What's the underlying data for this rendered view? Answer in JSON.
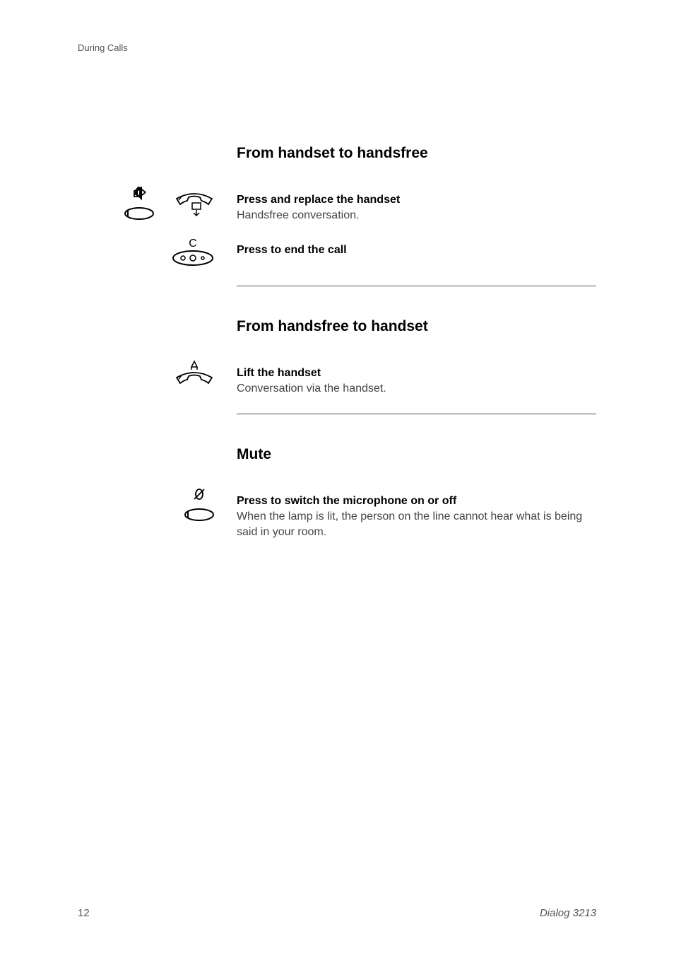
{
  "header": {
    "section_label": "During Calls"
  },
  "sections": [
    {
      "title": "From handset to handsfree",
      "rows": [
        {
          "bold": "Press and replace the handset",
          "plain": "Handsfree conversation."
        },
        {
          "bold": "Press to end the call",
          "plain": ""
        }
      ]
    },
    {
      "title": "From handsfree to handset",
      "rows": [
        {
          "bold": "Lift the handset",
          "plain": "Conversation via the handset."
        }
      ]
    },
    {
      "title": "Mute",
      "rows": [
        {
          "bold": "Press to switch the microphone on or off",
          "plain": "When the lamp is lit, the person on the line cannot hear what is being said in your room."
        }
      ]
    }
  ],
  "footer": {
    "page": "12",
    "model": "Dialog 3213"
  },
  "icons": {
    "speaker": "speaker-icon",
    "hangup": "handset-down-icon",
    "clear": "clear-button-icon",
    "pickup": "handset-up-icon",
    "mute": "mute-icon"
  }
}
